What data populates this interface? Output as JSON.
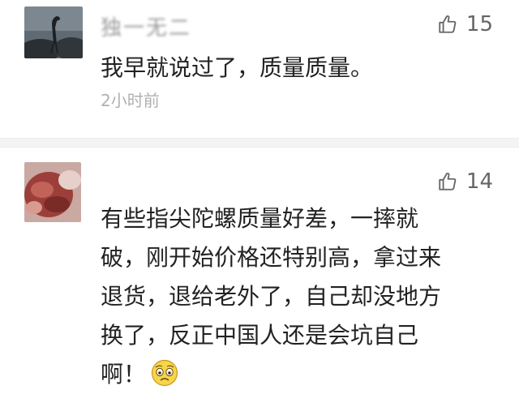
{
  "comments": [
    {
      "username": "独一无二",
      "likes": "15",
      "text_lines": [
        "我早就说过了，质量质量。"
      ],
      "time": "2小时前"
    },
    {
      "username": "",
      "likes": "14",
      "text_lines": [
        "有些指尖陀螺质量好差，一摔就",
        "破，刚开始价格还特别高，拿过来",
        "退货，退给老外了，自己却没地方",
        "换了，反正中国人还是会坑自己",
        "啊！"
      ]
    }
  ],
  "icons": {
    "like": "thumbs-up-icon",
    "emoji": "worried-face-emoji-icon"
  },
  "colors": {
    "text": "#222222",
    "meta": "#666666",
    "time": "#b0b0b0",
    "divider": "#f4f4f4"
  }
}
